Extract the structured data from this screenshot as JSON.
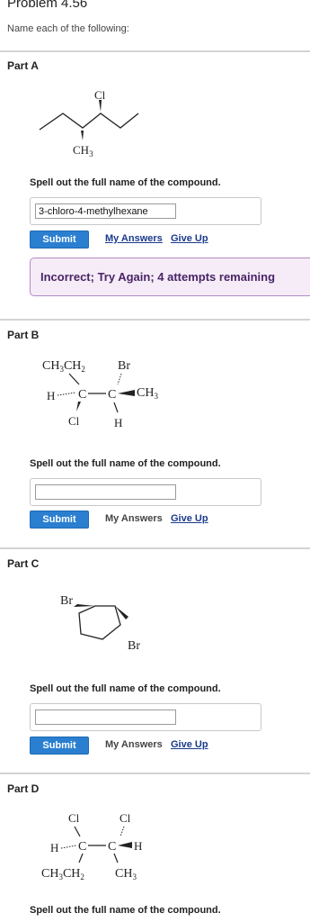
{
  "header": {
    "title": "Problem 4.56",
    "subtitle": "Name each of the following:"
  },
  "parts": {
    "a": {
      "label": "Part A",
      "prompt": "Spell out the full name of the compound.",
      "answer_value": "3-chloro-4-methylhexane",
      "submit_label": "Submit",
      "my_answers_label": "My Answers",
      "give_up_label": "Give Up",
      "feedback": "Incorrect; Try Again; 4 attempts remaining",
      "structure": {
        "cl": "Cl",
        "ch": "CH",
        "sub3": "3"
      }
    },
    "b": {
      "label": "Part B",
      "prompt": "Spell out the full name of the compound.",
      "answer_value": "",
      "submit_label": "Submit",
      "my_answers_label": "My Answers",
      "give_up_label": "Give Up",
      "structure": {
        "ethyl_ch": "CH",
        "ethyl_3": "3",
        "ethyl_ch2": "CH",
        "ethyl_2": "2",
        "br": "Br",
        "h_left": "H",
        "c1": "C",
        "c2": "C",
        "ch": "CH",
        "sub3": "3",
        "cl": "Cl",
        "h_bottom": "H"
      }
    },
    "c": {
      "label": "Part C",
      "prompt": "Spell out the full name of the compound.",
      "answer_value": "",
      "submit_label": "Submit",
      "my_answers_label": "My Answers",
      "give_up_label": "Give Up",
      "structure": {
        "br1": "Br",
        "br2": "Br"
      }
    },
    "d": {
      "label": "Part D",
      "prompt": "Spell out the full name of the compound.",
      "structure": {
        "cl1": "Cl",
        "cl2": "Cl",
        "h_left": "H",
        "c1": "C",
        "c2": "C",
        "h_right": "H",
        "ethyl_ch": "CH",
        "ethyl_3": "3",
        "ethyl_ch2": "CH",
        "ethyl_2": "2",
        "ch": "CH",
        "sub3": "3"
      }
    }
  },
  "colors": {
    "submit": "#2a7fd0",
    "link": "#1a3a8a",
    "feedback_bg": "#f5ecf7",
    "feedback_border": "#b48ac4"
  }
}
